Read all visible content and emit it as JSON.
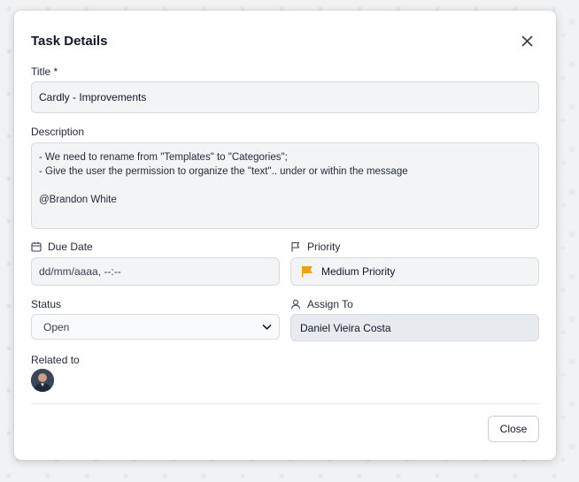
{
  "dialog": {
    "title": "Task Details",
    "close_icon": "close-icon"
  },
  "form": {
    "title_label": "Title *",
    "title_value": "Cardly - Improvements",
    "description_label": "Description",
    "description_value": "- We need to rename from \"Templates\" to \"Categories\";\n- Give the user the permission to organize the \"text\".. under or within the message\n\n@Brandon White",
    "due_date_label": "Due Date",
    "due_date_icon": "calendar-icon",
    "due_date_value": "dd/mm/aaaa, --:--",
    "priority_label": "Priority",
    "priority_icon": "flag-icon",
    "priority_value": "Medium Priority",
    "priority_color": "#e8a317",
    "status_label": "Status",
    "status_value": "Open",
    "assign_label": "Assign To",
    "assign_icon": "user-icon",
    "assign_value": "Daniel Vieira Costa",
    "related_label": "Related to",
    "related_avatar": "person-avatar"
  },
  "footer": {
    "close_label": "Close"
  }
}
